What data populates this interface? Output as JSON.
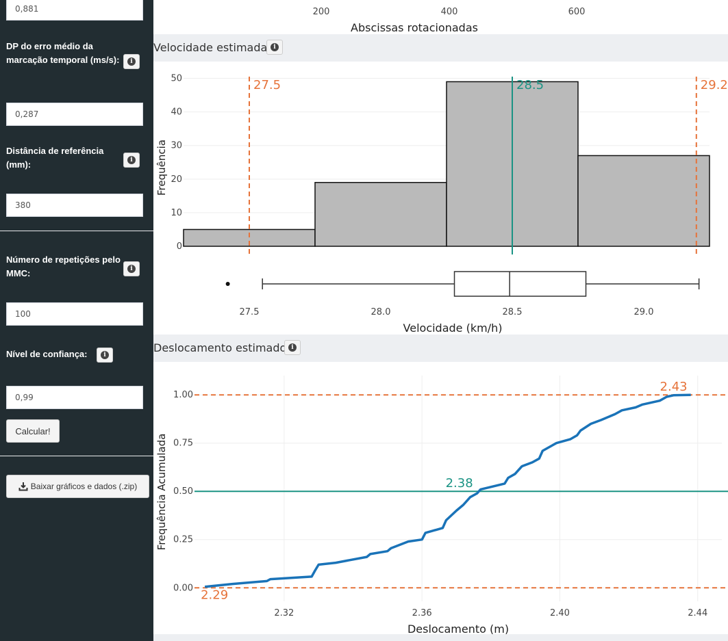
{
  "sidebar": {
    "top_value": "0,881",
    "dp_label": "DP do erro médio da marcação temporal (ms/s):",
    "dp_value": "0,287",
    "dist_label": "Distância de referência (mm):",
    "dist_value": "380",
    "rep_label": "Número de repetições pelo MMC:",
    "rep_value": "100",
    "conf_label": "Nível de confiança:",
    "conf_value": "0,99",
    "calc_button": "Calcular!",
    "download_button": "Baixar gráficos e dados (.zip)",
    "download_icon": "download-icon",
    "info_icon": "info-icon"
  },
  "top_axis": {
    "ticks": [
      "200",
      "400",
      "600"
    ],
    "xlabel": "Abscissas rotacionadas"
  },
  "sections": {
    "velocity_title": "Velocidade estimada",
    "displacement_title": "Deslocamento estimado"
  },
  "chart_data": [
    {
      "type": "bar",
      "subtype": "histogram+boxplot",
      "xlabel": "Velocidade (km/h)",
      "ylabel": "Frequência",
      "bins": [
        [
          27.25,
          27.75
        ],
        [
          27.75,
          28.25
        ],
        [
          28.25,
          28.75
        ],
        [
          28.75,
          29.25
        ]
      ],
      "values": [
        5,
        19,
        49,
        27
      ],
      "xticks": [
        "27.5",
        "28.0",
        "28.5",
        "29.0"
      ],
      "yticks": [
        "0",
        "10",
        "20",
        "30",
        "40",
        "50"
      ],
      "ylim": [
        0,
        55
      ],
      "xlim": [
        27.25,
        29.25
      ],
      "bar_color": "#bababa",
      "lines": [
        {
          "value": 27.5,
          "label": "27.5",
          "style": "dashed",
          "color": "#e6733a"
        },
        {
          "value": 28.5,
          "label": "28.5",
          "style": "solid",
          "color": "#1a9384"
        },
        {
          "value": 29.2,
          "label": "29.2",
          "style": "dashed",
          "color": "#e6733a"
        }
      ],
      "boxplot": {
        "whisker_low": 27.55,
        "q1": 28.28,
        "median": 28.49,
        "q3": 28.78,
        "whisker_high": 29.21,
        "outliers": [
          27.46
        ]
      }
    },
    {
      "type": "line",
      "subtype": "ecdf",
      "xlabel": "Deslocamento (m)",
      "ylabel": "Frequência Acumulada",
      "xticks": [
        "2.32",
        "2.36",
        "2.40",
        "2.44"
      ],
      "yticks": [
        "0.00",
        "0.25",
        "0.50",
        "0.75",
        "1.00"
      ],
      "xlim": [
        2.294,
        2.447
      ],
      "ylim": [
        -0.07,
        1.1
      ],
      "grid": true,
      "series": [
        {
          "color": "#1a73b8",
          "x": [
            2.297,
            2.305,
            2.315,
            2.316,
            2.328,
            2.329,
            2.33,
            2.335,
            2.344,
            2.345,
            2.35,
            2.351,
            2.356,
            2.36,
            2.361,
            2.366,
            2.367,
            2.37,
            2.372,
            2.374,
            2.376,
            2.377,
            2.384,
            2.385,
            2.387,
            2.389,
            2.392,
            2.394,
            2.395,
            2.398,
            2.399,
            2.403,
            2.405,
            2.406,
            2.409,
            2.412,
            2.416,
            2.418,
            2.422,
            2.424,
            2.429,
            2.431,
            2.433,
            2.438
          ],
          "y": [
            0.005,
            0.02,
            0.035,
            0.045,
            0.058,
            0.09,
            0.12,
            0.13,
            0.16,
            0.175,
            0.19,
            0.205,
            0.24,
            0.25,
            0.285,
            0.31,
            0.35,
            0.4,
            0.43,
            0.47,
            0.49,
            0.51,
            0.54,
            0.57,
            0.59,
            0.63,
            0.65,
            0.67,
            0.71,
            0.74,
            0.75,
            0.77,
            0.79,
            0.815,
            0.85,
            0.87,
            0.9,
            0.92,
            0.935,
            0.95,
            0.97,
            0.99,
            0.998,
            1.0
          ]
        }
      ],
      "lines": [
        {
          "axis": "y",
          "value": 1.0,
          "label": "2.43",
          "style": "dashed",
          "color": "#e6733a"
        },
        {
          "axis": "y",
          "value": 0.5,
          "label": "2.38",
          "style": "solid",
          "color": "#1a9384"
        },
        {
          "axis": "y",
          "value": 0.0,
          "label": "2.29",
          "style": "dashed",
          "color": "#e6733a"
        }
      ]
    }
  ]
}
